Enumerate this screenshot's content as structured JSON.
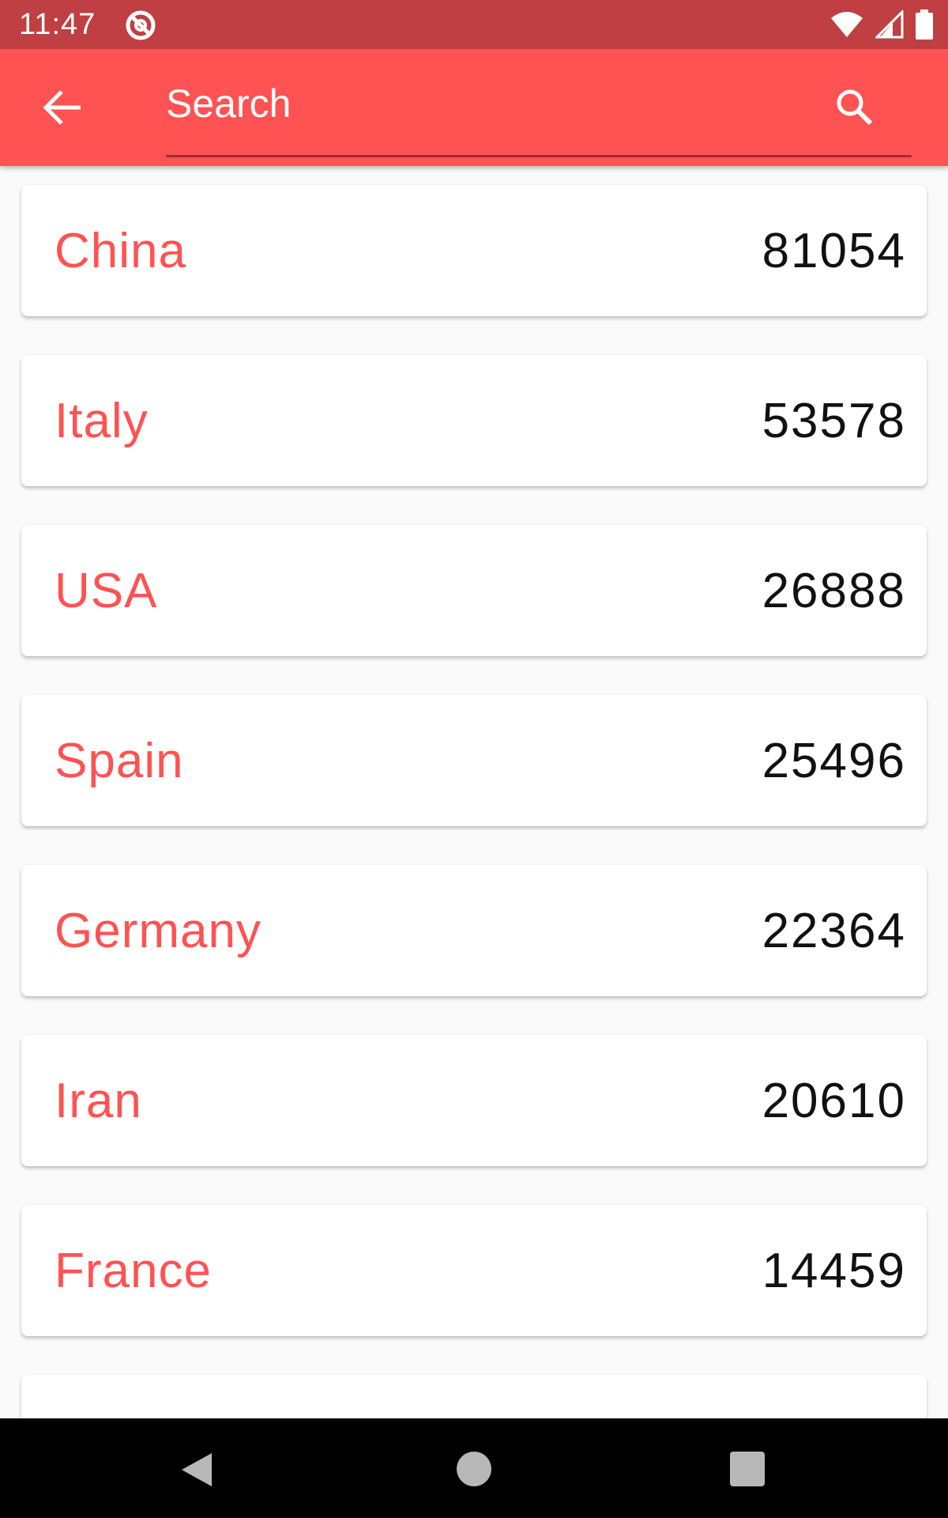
{
  "status_bar": {
    "time": "11:47",
    "icons": [
      "app-notification-icon",
      "wifi-icon",
      "cell-signal-icon",
      "battery-icon"
    ]
  },
  "app_bar": {
    "back_icon": "arrow-back-icon",
    "search_placeholder": "Search",
    "search_value": "",
    "search_icon": "search-icon",
    "color": "#ff5252"
  },
  "countries": [
    {
      "name": "China",
      "count": "81054"
    },
    {
      "name": "Italy",
      "count": "53578"
    },
    {
      "name": "USA",
      "count": "26888"
    },
    {
      "name": "Spain",
      "count": "25496"
    },
    {
      "name": "Germany",
      "count": "22364"
    },
    {
      "name": "Iran",
      "count": "20610"
    },
    {
      "name": "France",
      "count": "14459"
    },
    {
      "name": "",
      "count": ""
    }
  ],
  "nav_bar": {
    "icons": [
      "nav-back-icon",
      "nav-home-icon",
      "nav-recents-icon"
    ]
  },
  "colors": {
    "accent": "#ff5252",
    "status_bar": "#bf3f42",
    "count_text": "#111111"
  }
}
